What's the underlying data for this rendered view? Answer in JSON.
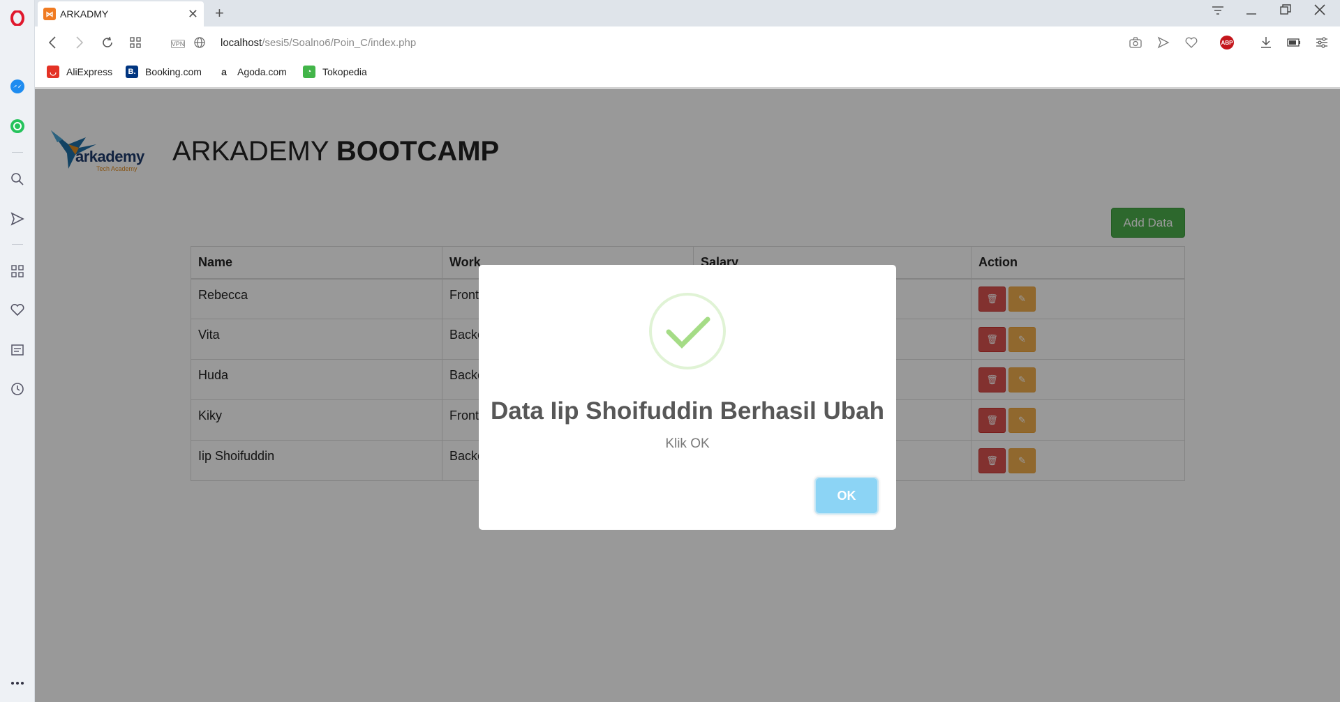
{
  "browser": {
    "tab_title": "ARKADMY",
    "tab_favicon_letter": "⋈",
    "url_host": "localhost",
    "url_path": "/sesi5/Soalno6/Poin_C/index.php",
    "vpn_label": "VPN",
    "abp_label": "ABP",
    "bookmarks": [
      {
        "label": "AliExpress",
        "icon": "aliexpress-icon",
        "color": "#e43225"
      },
      {
        "label": "Booking.com",
        "icon": "booking-icon",
        "color": "#003580"
      },
      {
        "label": "Agoda.com",
        "icon": "agoda-icon",
        "color": "#ffffff"
      },
      {
        "label": "Tokopedia",
        "icon": "tokopedia-icon",
        "color": "#42b549"
      }
    ]
  },
  "page": {
    "logo_text": "arkademy",
    "logo_sub": "Tech Academy",
    "heading_light": "ARKADEMY ",
    "heading_bold": "BOOTCAMP",
    "add_button": "Add Data",
    "table": {
      "columns": [
        "Name",
        "Work",
        "Salary",
        "Action"
      ],
      "rows": [
        {
          "name": "Rebecca",
          "work": "Front"
        },
        {
          "name": "Vita",
          "work": "Backe"
        },
        {
          "name": "Huda",
          "work": "Backe"
        },
        {
          "name": "Kiky",
          "work": "Front"
        },
        {
          "name": "Iip Shoifuddin",
          "work": "Backe"
        }
      ]
    }
  },
  "modal": {
    "title": "Data Iip Shoifuddin Berhasil Ubah",
    "text": "Klik OK",
    "ok_label": "OK",
    "icon": "success-check-icon"
  },
  "colors": {
    "add_button": "#4cae4c",
    "delete_button": "#d9534f",
    "edit_button": "#f0ad4e",
    "ok_button": "#8cd4f5",
    "check": "#a5dc86"
  }
}
